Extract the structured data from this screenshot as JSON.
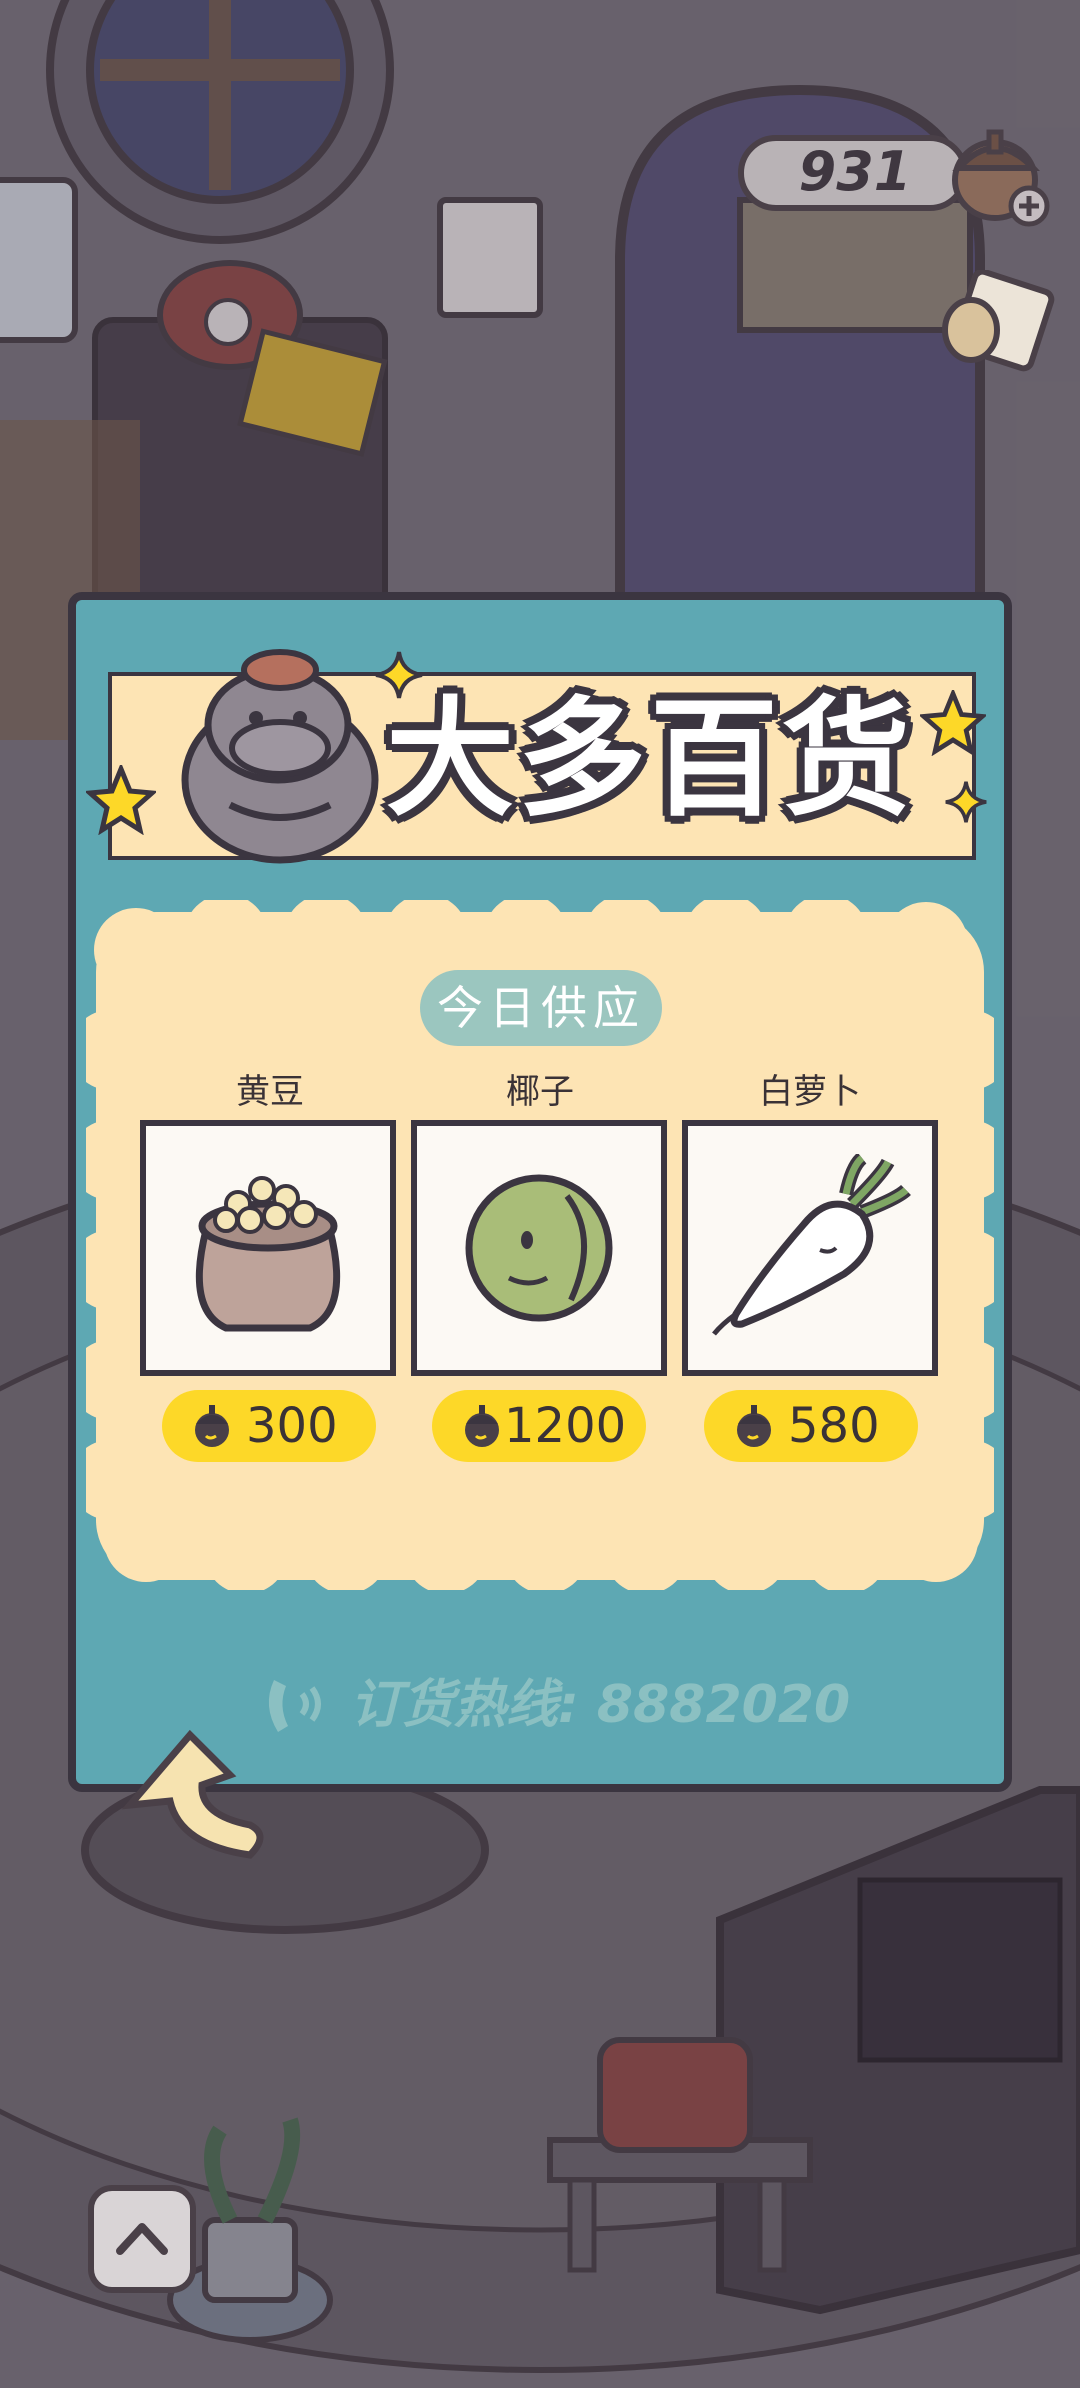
{
  "currency": {
    "amount": "931",
    "plus_icon": "plus-icon",
    "acorn_icon": "acorn-icon"
  },
  "shop": {
    "title": "大多百货",
    "supply_label": "今日供应",
    "items": [
      {
        "name": "黄豆",
        "price": "300",
        "icon": "soybean-sack-icon"
      },
      {
        "name": "椰子",
        "price": "1200",
        "icon": "coconut-icon"
      },
      {
        "name": "白萝卜",
        "price": "580",
        "icon": "radish-icon"
      }
    ],
    "hotline": "订货热线: 8882020"
  },
  "colors": {
    "panel": "#5ea8b3",
    "cream": "#fde4b4",
    "price_pill": "#fdd828",
    "outline": "#3b3540",
    "supply_badge": "#9bc6bf"
  }
}
